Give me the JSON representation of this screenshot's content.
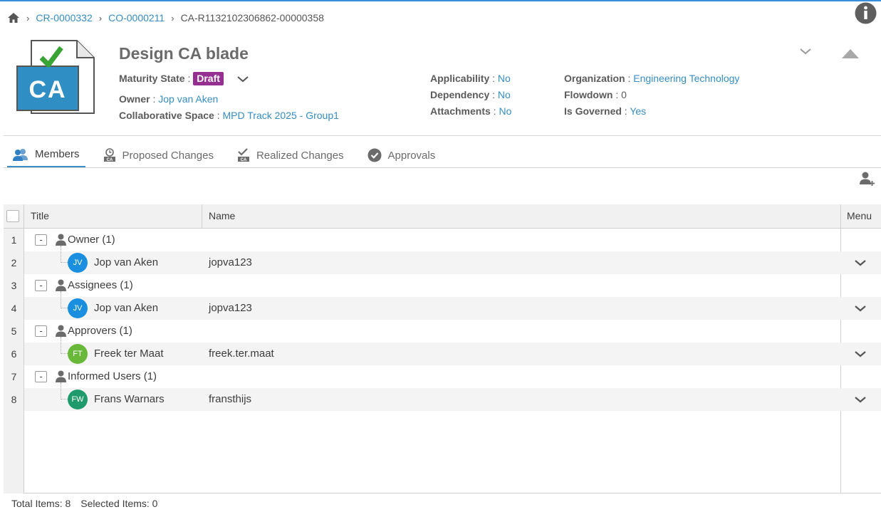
{
  "breadcrumb": {
    "items": [
      {
        "label": "CR-0000332"
      },
      {
        "label": "CO-0000211"
      },
      {
        "label": "CA-R1132102306862-00000358"
      }
    ]
  },
  "header": {
    "icon_text": "CA",
    "title": "Design CA blade",
    "maturity": {
      "label": "Maturity State",
      "value": "Draft",
      "badge_color": "#962f92"
    },
    "owner": {
      "label": "Owner",
      "value": "Jop van Aken"
    },
    "collab_space": {
      "label": "Collaborative Space",
      "value": "MPD Track 2025 - Group1"
    },
    "applicability": {
      "label": "Applicability",
      "value": "No"
    },
    "dependency": {
      "label": "Dependency",
      "value": "No"
    },
    "attachments": {
      "label": "Attachments",
      "value": "No"
    },
    "organization": {
      "label": "Organization",
      "value": "Engineering Technology"
    },
    "flowdown": {
      "label": "Flowdown",
      "value": "0"
    },
    "is_governed": {
      "label": "Is Governed",
      "value": "Yes"
    }
  },
  "tabs": [
    {
      "label": "Members",
      "icon": "members-icon",
      "active": true
    },
    {
      "label": "Proposed Changes",
      "icon": "proposed-changes-icon",
      "active": false
    },
    {
      "label": "Realized Changes",
      "icon": "realized-changes-icon",
      "active": false
    },
    {
      "label": "Approvals",
      "icon": "approvals-icon",
      "active": false
    }
  ],
  "grid": {
    "columns": {
      "title": "Title",
      "name": "Name",
      "menu": "Menu"
    },
    "rows": [
      {
        "num": "1",
        "type": "group",
        "label": "Owner (1)"
      },
      {
        "num": "2",
        "type": "user",
        "initials": "JV",
        "avatar_color": "#1a8fe0",
        "title": "Jop van Aken",
        "name": "jopva123"
      },
      {
        "num": "3",
        "type": "group",
        "label": "Assignees (1)"
      },
      {
        "num": "4",
        "type": "user",
        "initials": "JV",
        "avatar_color": "#1a8fe0",
        "title": "Jop van Aken",
        "name": "jopva123"
      },
      {
        "num": "5",
        "type": "group",
        "label": "Approvers (1)"
      },
      {
        "num": "6",
        "type": "user",
        "initials": "FT",
        "avatar_color": "#6ab83a",
        "title": "Freek ter Maat",
        "name": "freek.ter.maat"
      },
      {
        "num": "7",
        "type": "group",
        "label": "Informed Users (1)"
      },
      {
        "num": "8",
        "type": "user",
        "initials": "FW",
        "avatar_color": "#1f9a6c",
        "title": "Frans Warnars",
        "name": "fransthijs"
      }
    ]
  },
  "footer": {
    "total": "Total Items: 8",
    "selected": "Selected Items: 0"
  }
}
